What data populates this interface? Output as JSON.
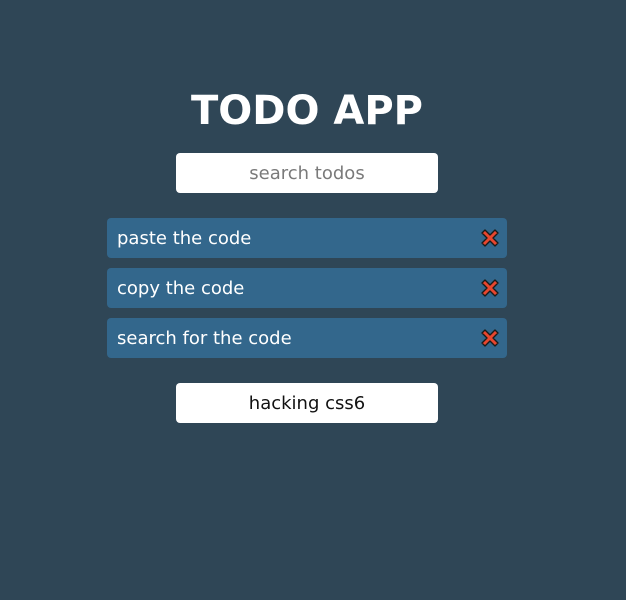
{
  "app": {
    "title": "TODO APP"
  },
  "search": {
    "placeholder": "search todos",
    "value": ""
  },
  "todos": [
    {
      "text": "paste the code",
      "delete_icon": "close-icon"
    },
    {
      "text": "copy the code",
      "delete_icon": "close-icon"
    },
    {
      "text": "search for the code",
      "delete_icon": "close-icon"
    }
  ],
  "add_todo": {
    "value": "hacking css6"
  },
  "colors": {
    "background": "#2f4656",
    "todo_item": "#33678c",
    "delete_icon": "#e8462e"
  }
}
